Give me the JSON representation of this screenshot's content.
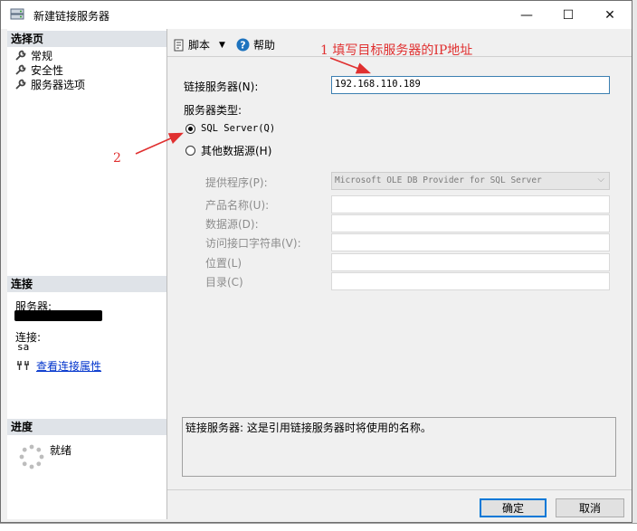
{
  "window": {
    "title": "新建链接服务器",
    "controls": {
      "minimize": "—",
      "maximize": "☐",
      "close": "✕"
    }
  },
  "leftpane": {
    "select_page_header": "选择页",
    "nav": [
      "常规",
      "安全性",
      "服务器选项"
    ],
    "connection_header": "连接",
    "server_label": "服务器:",
    "connection_label": "连接:",
    "connection_value": "sa",
    "view_props_link": "查看连接属性",
    "progress_header": "进度",
    "progress_status": "就绪"
  },
  "toolbar": {
    "script_label": "脚本",
    "help_label": "帮助"
  },
  "form": {
    "linked_server_label": "链接服务器(N):",
    "linked_server_value": "192.168.110.189",
    "server_type_label": "服务器类型:",
    "radio_sql": "SQL Server(Q)",
    "radio_other": "其他数据源(H)",
    "provider_label": "提供程序(P):",
    "provider_value": "Microsoft OLE DB Provider for SQL Server",
    "product_label": "产品名称(U):",
    "datasource_label": "数据源(D):",
    "provider_string_label": "访问接口字符串(V):",
    "location_label": "位置(L)",
    "catalog_label": "目录(C)"
  },
  "description": "链接服务器: 这是引用链接服务器时将使用的名称。",
  "buttons": {
    "ok": "确定",
    "cancel": "取消"
  },
  "annotations": {
    "step1": "1 填写目标服务器的IP地址",
    "step2": "2"
  },
  "colors": {
    "annotation": "#e03030",
    "link": "#0033cc",
    "section_header": "#dfe3e8"
  }
}
